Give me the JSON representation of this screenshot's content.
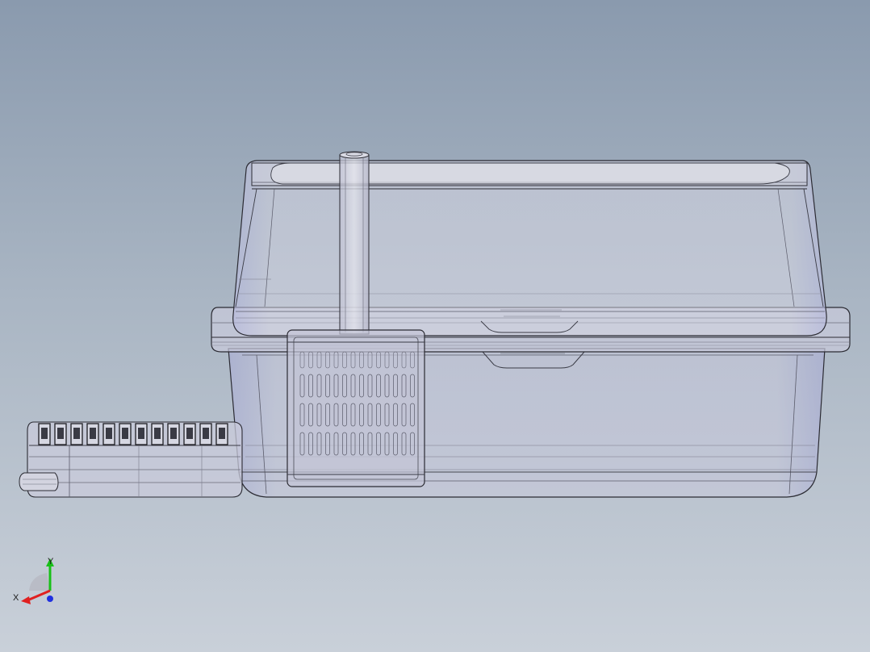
{
  "viewport": {
    "background_top": "#8a9aae",
    "background_bottom": "#c9d0d9",
    "model_edge_color": "#2b2b33",
    "model_fill": "#c4c7d8",
    "accent_purple": "#9c9ccf"
  },
  "triad": {
    "x_label": "X",
    "y_label": "Y",
    "x_color": "#e02020",
    "y_color": "#18c018",
    "z_color": "#2030e0"
  }
}
